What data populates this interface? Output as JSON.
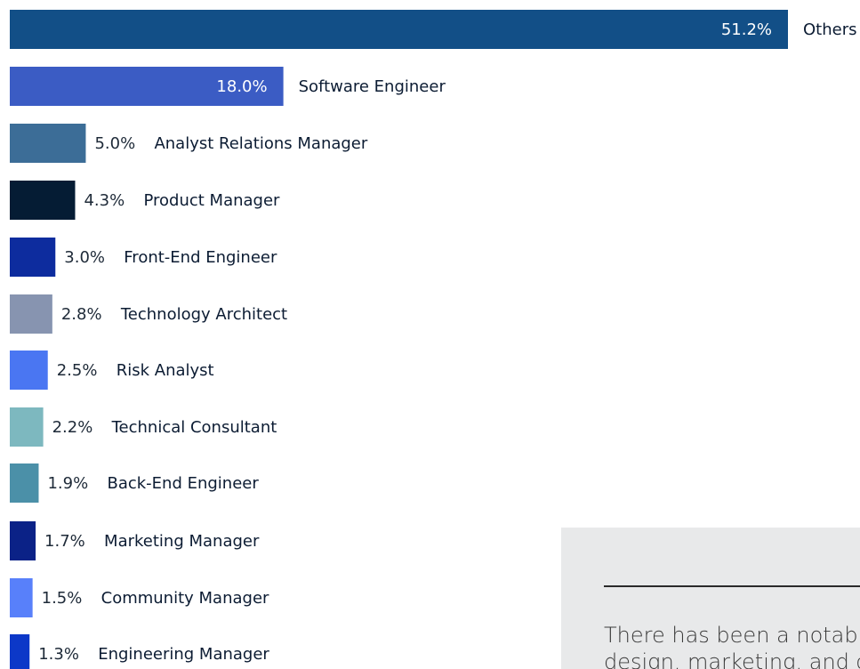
{
  "chart_data": {
    "type": "bar",
    "orientation": "horizontal",
    "categories": [
      "Others",
      "Software Engineer",
      "Analyst Relations Manager",
      "Product Manager",
      "Front-End Engineer",
      "Technology Architect",
      "Risk Analyst",
      "Technical Consultant",
      "Back-End Engineer",
      "Marketing Manager",
      "Community Manager",
      "Engineering Manager"
    ],
    "values": [
      51.2,
      18.0,
      5.0,
      4.3,
      3.0,
      2.8,
      2.5,
      2.2,
      1.9,
      1.7,
      1.5,
      1.3
    ],
    "value_labels": [
      "51.2%",
      "18.0%",
      "5.0%",
      "4.3%",
      "3.0%",
      "2.8%",
      "2.5%",
      "2.2%",
      "1.9%",
      "1.7%",
      "1.5%",
      "1.3%"
    ],
    "colors": [
      "#124f87",
      "#3b5cc4",
      "#3c6d97",
      "#051c34",
      "#0d2c9e",
      "#8794b0",
      "#4a76f2",
      "#7db8bf",
      "#4b90a8",
      "#0b2287",
      "#5880fa",
      "#0c38c8"
    ],
    "unit": "%",
    "title": "",
    "xlabel": "",
    "ylabel": "",
    "grid": false,
    "legend": "none"
  },
  "note": {
    "text": "There has been a notable rise in roles across design, marketing, and community"
  }
}
